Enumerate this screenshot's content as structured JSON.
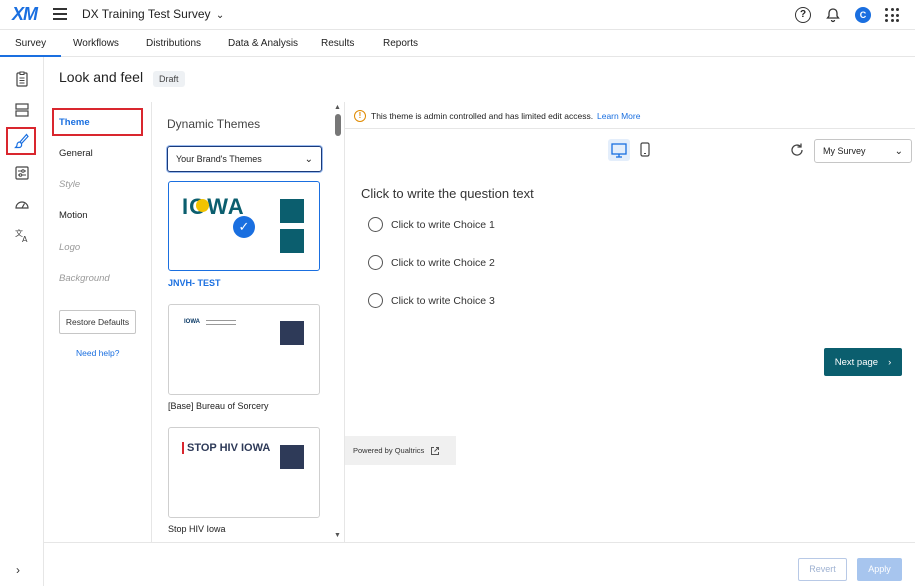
{
  "header": {
    "logo": "XM",
    "project_title": "DX Training Test Survey",
    "avatar_initial": "C",
    "help_glyph": "?"
  },
  "tabs": [
    {
      "label": "Survey",
      "active": true
    },
    {
      "label": "Workflows"
    },
    {
      "label": "Distributions"
    },
    {
      "label": "Data & Analysis"
    },
    {
      "label": "Results"
    },
    {
      "label": "Reports"
    }
  ],
  "rail_icons": [
    "survey-flow-icon",
    "blocks-icon",
    "look-and-feel-brush-icon",
    "survey-options-icon",
    "dashboard-gauge-icon",
    "translate-icon"
  ],
  "page": {
    "title": "Look and feel",
    "status": "Draft"
  },
  "subnav": {
    "items": [
      {
        "label": "Theme",
        "state": "active"
      },
      {
        "label": "General",
        "state": "enabled"
      },
      {
        "label": "Style",
        "state": "disabled"
      },
      {
        "label": "Motion",
        "state": "enabled"
      },
      {
        "label": "Logo",
        "state": "disabled"
      },
      {
        "label": "Background",
        "state": "disabled"
      }
    ],
    "restore_label": "Restore Defaults",
    "help_label": "Need help?"
  },
  "themes": {
    "title": "Dynamic Themes",
    "select_value": "Your Brand's Themes",
    "cards": [
      {
        "name": "JNVH- TEST",
        "logo_text": "IOWA",
        "selected": true,
        "swatch": "#0b5e6e"
      },
      {
        "name": "[Base] Bureau of Sorcery",
        "logo_text": "IOWA",
        "selected": false,
        "swatch": "#2e3a58"
      },
      {
        "name": "Stop HIV Iowa",
        "logo_text": "STOP HIV IOWA",
        "selected": false,
        "swatch": "#2e3a58"
      }
    ]
  },
  "notice": {
    "text": "This theme is admin controlled and has limited edit access.",
    "link": "Learn More"
  },
  "preview": {
    "survey_select": "My Survey",
    "question": "Click to write the question text",
    "choices": [
      "Click to write Choice 1",
      "Click to write Choice 2",
      "Click to write Choice 3"
    ],
    "next_label": "Next page",
    "powered_by": "Powered by Qualtrics"
  },
  "footer": {
    "revert_label": "Revert",
    "apply_label": "Apply"
  },
  "colors": {
    "accent": "#1a6fe0",
    "highlight_box": "#d9262e",
    "theme_primary": "#0b5e6e",
    "theme_secondary": "#2e3a58",
    "apply_disabled": "#a7c5ee"
  }
}
